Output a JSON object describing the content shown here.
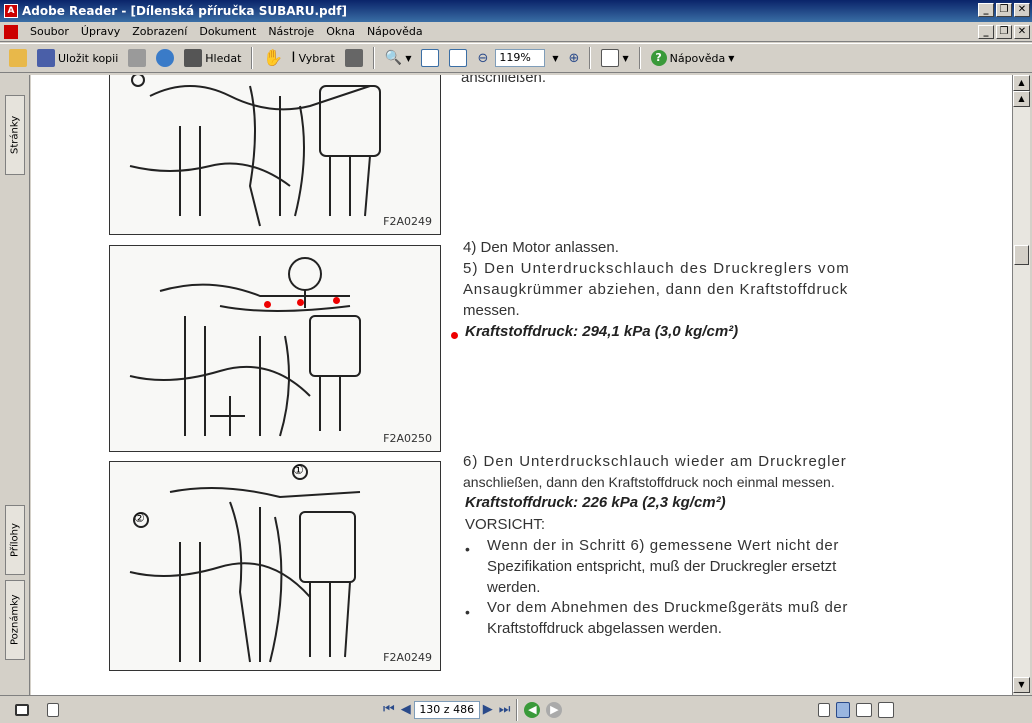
{
  "window": {
    "title": "Adobe Reader - [Dílenská příručka SUBARU.pdf]",
    "min": "_",
    "max": "❐",
    "close": "✕"
  },
  "menu": [
    "Soubor",
    "Úpravy",
    "Zobrazení",
    "Dokument",
    "Nástroje",
    "Okna",
    "Nápověda"
  ],
  "toolbar": {
    "save_copy": "Uložit kopii",
    "search": "Hledat",
    "select": "Vybrat",
    "zoom": "119%",
    "help": "Nápověda"
  },
  "left_tabs": {
    "pages": "Stránky",
    "attachments": "Přílohy",
    "comments": "Poznámky"
  },
  "status": {
    "page": "130 z 486"
  },
  "doc": {
    "fig1_label": "F2A0249",
    "fig2_label": "F2A0250",
    "fig3_label": "F2A0249",
    "top_text": "anschließen.",
    "step4": "4) Den Motor anlassen.",
    "step5_l1": "5) Den Unterdruckschlauch des Druckreglers vom",
    "step5_l2": "Ansaugkrümmer abziehen, dann den Kraftstoffdruck",
    "step5_l3": "messen.",
    "spec1": "Kraftstoffdruck: 294,1 kPa (3,0 kg/cm²)",
    "step6_l1": "6) Den Unterdruckschlauch wieder am Druckregler",
    "step6_l2": "anschließen, dann den Kraftstoffdruck noch einmal messen.",
    "spec2": "Kraftstoffdruck: 226 kPa (2,3 kg/cm²)",
    "caution": "VORSICHT:",
    "bullet1_l1": "Wenn der in Schritt 6) gemessene Wert nicht der",
    "bullet1_l2": "Spezifikation entspricht, muß der Druckregler ersetzt",
    "bullet1_l3": "werden.",
    "bullet2_l1": "Vor dem Abnehmen des Druckmeßgeräts muß der",
    "bullet2_l2": "Kraftstoffdruck abgelassen werden.",
    "callout1": "①",
    "callout2": "②"
  },
  "colors": {
    "titlebar": "#0a246a",
    "annotation_dot": "#e00000"
  }
}
